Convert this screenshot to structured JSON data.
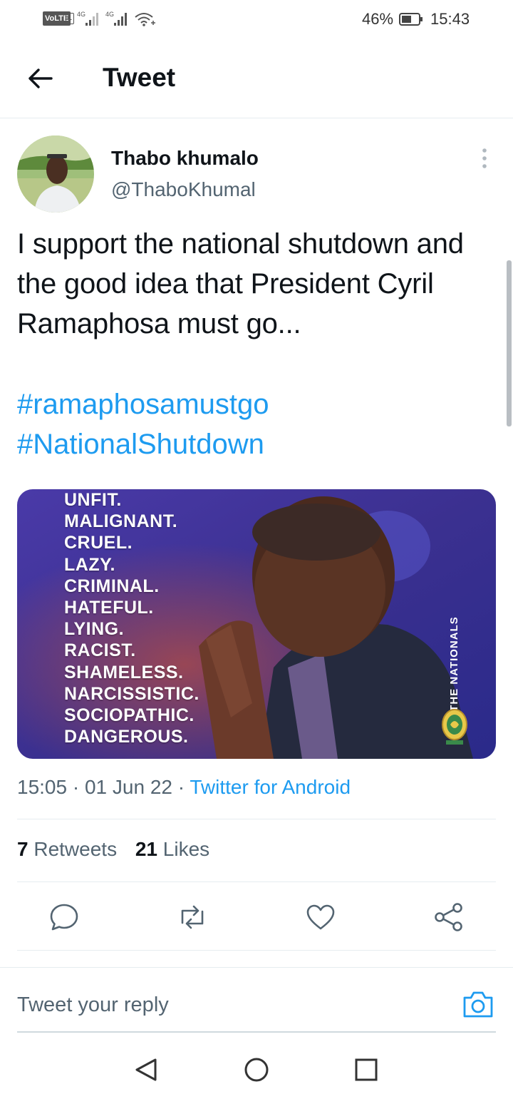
{
  "status_bar": {
    "volte": "VoLTE",
    "sim": "1",
    "network_1": "4G",
    "network_2": "4G",
    "battery_percent": "46%",
    "time": "15:43"
  },
  "header": {
    "title": "Tweet",
    "back_icon": "arrow-left-icon"
  },
  "author": {
    "display_name": "Thabo khumalo",
    "handle": "@ThaboKhumal",
    "more_icon": "more-vertical-icon"
  },
  "tweet": {
    "text": "I support the national shutdown and the good idea that President Cyril Ramaphosa must go...",
    "hashtags": [
      "#ramaphosamustgo",
      "#NationalShutdown"
    ]
  },
  "image": {
    "words": [
      "UNFIT.",
      "MALIGNANT.",
      "CRUEL.",
      "LAZY.",
      "CRIMINAL.",
      "HATEFUL.",
      "LYING.",
      "RACIST.",
      "SHAMELESS.",
      "NARCISSISTIC.",
      "SOCIOPATHIC.",
      "DANGEROUS."
    ],
    "brand": "THE NATIONALS"
  },
  "meta": {
    "time": "15:05",
    "date": "01 Jun 22",
    "separator": "·",
    "source": "Twitter for Android"
  },
  "stats": {
    "retweets_count": "7",
    "retweets_label": "Retweets",
    "likes_count": "21",
    "likes_label": "Likes"
  },
  "actions": [
    "reply-icon",
    "retweet-icon",
    "like-icon",
    "share-icon"
  ],
  "reply": {
    "placeholder": "Tweet your reply",
    "camera_icon": "camera-icon"
  },
  "nav": [
    "nav-back-icon",
    "nav-home-icon",
    "nav-recents-icon"
  ],
  "colors": {
    "accent": "#1d9bf0",
    "text": "#0f1419",
    "secondary": "#536471"
  }
}
